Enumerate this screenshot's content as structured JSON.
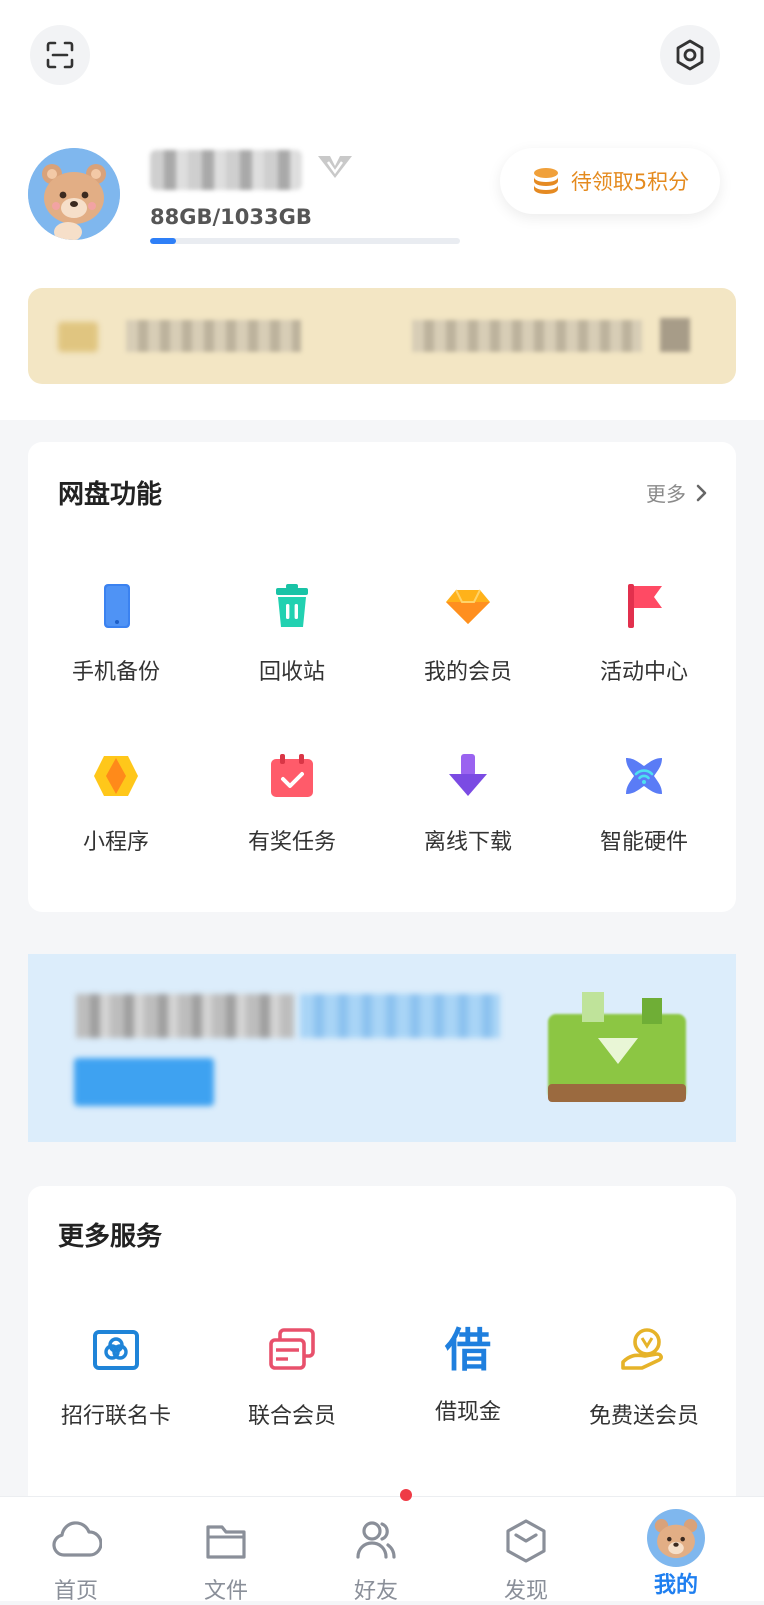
{
  "header": {
    "storage_text": "88GB/1033GB",
    "storage_used_fraction": 0.085,
    "points_label": "待领取5积分",
    "icons": [
      "scan-icon",
      "settings-icon",
      "vip-chevron-icon",
      "coin-stack-icon"
    ]
  },
  "features": {
    "title": "网盘功能",
    "more_label": "更多",
    "items": [
      {
        "label": "手机备份",
        "icon": "phone-backup-icon"
      },
      {
        "label": "回收站",
        "icon": "recycle-bin-icon"
      },
      {
        "label": "我的会员",
        "icon": "diamond-icon"
      },
      {
        "label": "活动中心",
        "icon": "flag-icon"
      },
      {
        "label": "小程序",
        "icon": "mini-program-icon"
      },
      {
        "label": "有奖任务",
        "icon": "calendar-task-icon"
      },
      {
        "label": "离线下载",
        "icon": "download-arrow-icon"
      },
      {
        "label": "智能硬件",
        "icon": "wifi-device-icon"
      }
    ]
  },
  "services": {
    "title": "更多服务",
    "items": [
      {
        "label": "招行联名卡",
        "icon": "bank-card-icon"
      },
      {
        "label": "联合会员",
        "icon": "member-cards-icon"
      },
      {
        "label": "借现金",
        "icon": "borrow-icon",
        "glyph": "借"
      },
      {
        "label": "免费送会员",
        "icon": "free-vip-icon"
      }
    ]
  },
  "tabs": [
    {
      "label": "首页",
      "icon": "cloud-icon",
      "active": false
    },
    {
      "label": "文件",
      "icon": "folder-icon",
      "active": false
    },
    {
      "label": "好友",
      "icon": "friends-icon",
      "active": false,
      "badge": true
    },
    {
      "label": "发现",
      "icon": "cube-icon",
      "active": false
    },
    {
      "label": "我的",
      "icon": "avatar-icon",
      "active": true
    }
  ],
  "colors": {
    "accent_blue": "#2e7ff7",
    "points_orange": "#e48a1e",
    "active_tab": "#1f7ff0",
    "badge_red": "#ef3b46"
  }
}
